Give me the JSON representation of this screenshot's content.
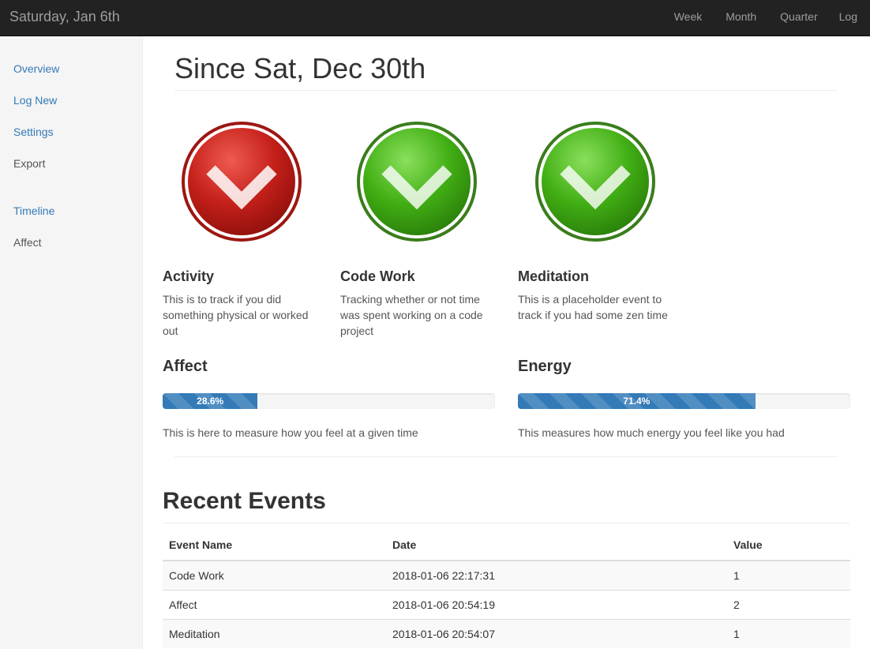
{
  "navbar": {
    "brand": "Saturday, Jan 6th",
    "links": [
      "Week",
      "Month",
      "Quarter",
      "Log"
    ]
  },
  "sidebar": {
    "items": [
      {
        "label": "Overview"
      },
      {
        "label": "Log New"
      },
      {
        "label": "Settings"
      },
      {
        "label": "Export"
      },
      {
        "label": "Timeline"
      },
      {
        "label": "Affect"
      }
    ]
  },
  "main": {
    "title": "Since Sat, Dec 30th",
    "trackers": [
      {
        "name": "Activity",
        "description": "This is to track if you did something physical or worked out",
        "status": "missed",
        "icon": "checkmark-icon",
        "color": "#c9221b"
      },
      {
        "name": "Code Work",
        "description": "Tracking whether or not time was spent working on a code project",
        "status": "done",
        "icon": "checkmark-icon",
        "color": "#3fae12"
      },
      {
        "name": "Meditation",
        "description": "This is a placeholder event to track if you had some zen time",
        "status": "done",
        "icon": "checkmark-icon",
        "color": "#3fae12"
      }
    ],
    "metrics": [
      {
        "name": "Affect",
        "value": 28.6,
        "label": "28.6%",
        "description": "This is here to measure how you feel at a given time"
      },
      {
        "name": "Energy",
        "value": 71.4,
        "label": "71.4%",
        "description": "This measures how much energy you feel like you had"
      }
    ]
  },
  "recent": {
    "title": "Recent Events",
    "headers": [
      "Event Name",
      "Date",
      "Value"
    ],
    "rows": [
      [
        "Code Work",
        "2018-01-06 22:17:31",
        "1"
      ],
      [
        "Affect",
        "2018-01-06 20:54:19",
        "2"
      ],
      [
        "Meditation",
        "2018-01-06 20:54:07",
        "1"
      ]
    ]
  },
  "colors": {
    "accent": "#337ab7",
    "navbar": "#222222",
    "success": "#3fae12",
    "danger": "#c9221b"
  }
}
